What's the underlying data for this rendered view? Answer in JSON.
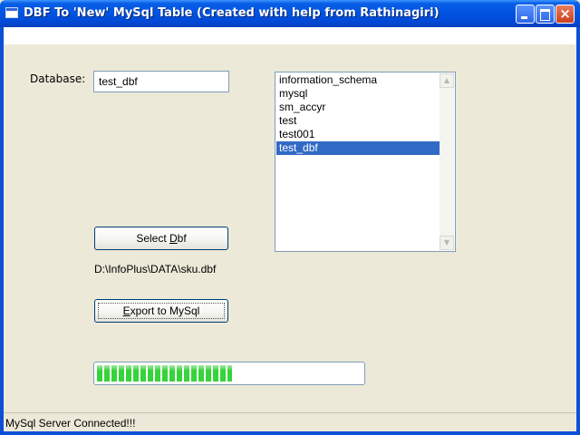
{
  "window": {
    "title": "DBF To 'New' MySql Table (Created with help from Rathinagiri)",
    "controls": [
      "minimize",
      "maximize",
      "close"
    ]
  },
  "form": {
    "database_label": "Database:",
    "database_value": "test_dbf",
    "databases": [
      {
        "label": "information_schema",
        "selected": false
      },
      {
        "label": "mysql",
        "selected": false
      },
      {
        "label": "sm_accyr",
        "selected": false
      },
      {
        "label": "test",
        "selected": false
      },
      {
        "label": "test001",
        "selected": false
      },
      {
        "label": "test_dbf",
        "selected": true
      }
    ],
    "select_dbf_button": {
      "before": "Select ",
      "accel": "D",
      "after": "bf"
    },
    "dbf_path": "D:\\InfoPlus\\DATA\\sku.dbf",
    "export_button": {
      "before": "",
      "accel": "E",
      "after": "xport to MySql"
    },
    "progress_percent": 51
  },
  "statusbar": {
    "text": "MySql Server Connected!!!"
  },
  "colors": {
    "titlebar": "#0054e3",
    "selection": "#316ac5",
    "progress": "#37d33a",
    "face": "#ece9d8"
  }
}
